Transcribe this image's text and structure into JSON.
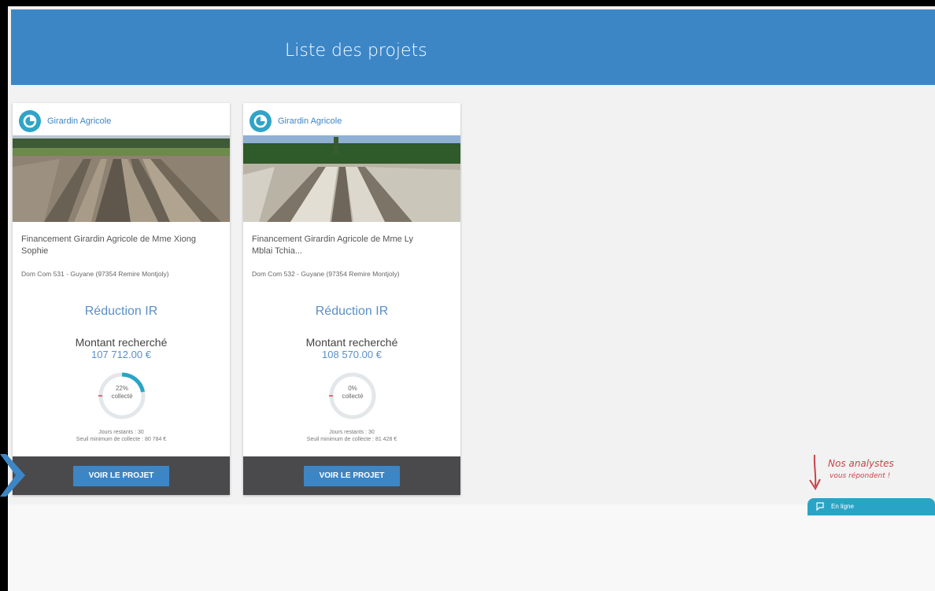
{
  "header": {
    "title": "Liste des projets"
  },
  "projects": [
    {
      "category": "Girardin Agricole",
      "title": "Financement Girardin Agricole de Mme Xiong Sophie",
      "location": "Dom Com 531 - Guyane (97354 Remire Montjoly)",
      "reduction": "Réduction IR",
      "amount_label": "Montant recherché",
      "amount": "107 712.00 €",
      "collected_percent": "22%",
      "collected_fraction": 0.22,
      "collected_label": "collecté",
      "days_remaining": "Jours restants : 30",
      "min_threshold": "Seuil minimum de collecte : 80 784 €",
      "button": "VOIR LE PROJET"
    },
    {
      "category": "Girardin Agricole",
      "title": "Financement Girardin Agricole de Mme Ly Mblai Tchia...",
      "location": "Dom Com 532 - Guyane (97354 Remire Montjoly)",
      "reduction": "Réduction IR",
      "amount_label": "Montant recherché",
      "amount": "108 570.00 €",
      "collected_percent": "0%",
      "collected_fraction": 0,
      "collected_label": "collecté",
      "days_remaining": "Jours restants : 30",
      "min_threshold": "Seuil minimum de collecte : 81 428 €",
      "button": "VOIR LE PROJET"
    }
  ],
  "help": {
    "line1": "Nos analystes",
    "line2": "vous répondent !"
  },
  "chat": {
    "label": "En ligne"
  },
  "icons": {
    "category": "pie-chart-icon",
    "nav": "chevron-right-icon",
    "help": "arrow-down-icon",
    "chat": "chat-bubble-icon"
  },
  "colors": {
    "header": "#3d86c6",
    "accent": "#2fa4c8",
    "footer": "#4a4a4d",
    "help": "#c9434b"
  }
}
